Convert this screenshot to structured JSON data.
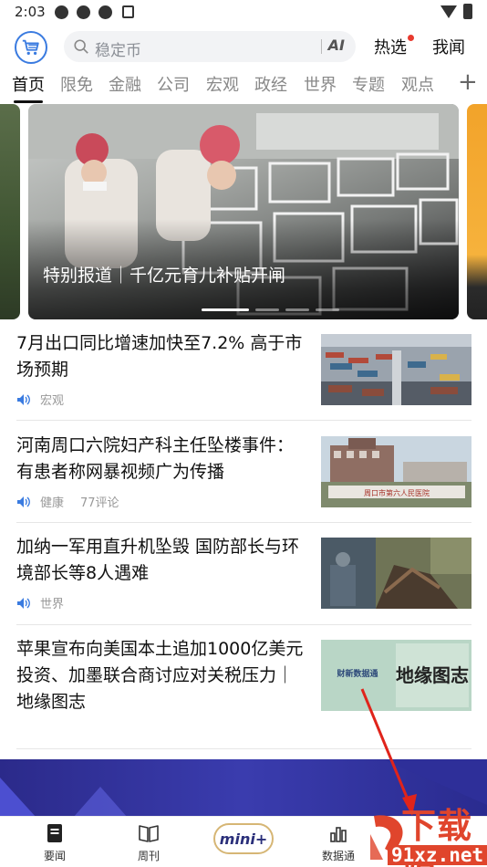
{
  "status_bar": {
    "time": "2:03"
  },
  "header": {
    "search_placeholder": "稳定币",
    "ai_label": "AI",
    "hot_label": "热选",
    "mine_label": "我闻"
  },
  "tabs": [
    "首页",
    "限免",
    "金融",
    "公司",
    "宏观",
    "政经",
    "世界",
    "专题",
    "观点"
  ],
  "tabs_plus": "+",
  "banner": {
    "caption": "特别报道｜千亿元育儿补贴开闸",
    "slide_count": 4,
    "active_slide": 1
  },
  "news": [
    {
      "title": "7月出口同比增速加快至7.2% 高于市场预期",
      "category": "宏观",
      "comments": ""
    },
    {
      "title": "河南周口六院妇产科主任坠楼事件：有患者称网暴视频广为传播",
      "category": "健康",
      "comments": "77评论"
    },
    {
      "title": "加纳一军用直升机坠毁 国防部长与环境部长等8人遇难",
      "category": "世界",
      "comments": ""
    },
    {
      "title": "苹果宣布向美国本土追加1000亿美元投资、加墨联合商讨应对关税压力｜地缘图志",
      "category": "",
      "comments": "",
      "thumb_text_left": "财新数据通",
      "thumb_text_right": "地缘图志"
    }
  ],
  "thumb_sign": "周口市第六人民医院",
  "bottom_nav": {
    "items": [
      "要闻",
      "周刊",
      "数据通"
    ],
    "mini_label": "mini+"
  },
  "watermark": {
    "text": "下载站",
    "url": "91xz.net"
  }
}
